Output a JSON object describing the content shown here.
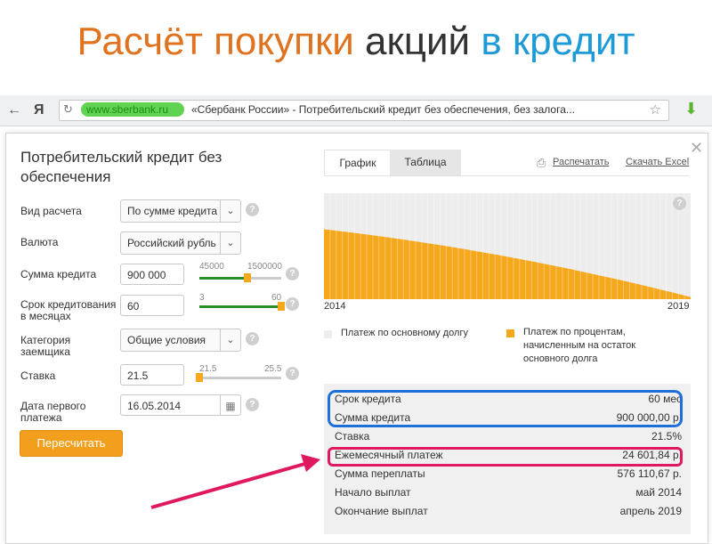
{
  "slide": {
    "title_part1": "Расчёт покупки",
    "title_part2": "акций",
    "title_part3": "в кредит"
  },
  "browser": {
    "back_icon": "←",
    "yandex_logo": "Я",
    "reload_icon": "↻",
    "url": "www.sberbank.ru",
    "page_title": "«Сбербанк России» - Потребительский кредит без обеспечения, без залога...",
    "star_icon": "☆",
    "download_icon": "⬇"
  },
  "dialog": {
    "title": "Потребительский кредит без обеспечения",
    "close_icon": "✕",
    "fields": {
      "calc_type": {
        "label": "Вид расчета",
        "value": "По сумме кредита"
      },
      "currency": {
        "label": "Валюта",
        "value": "Российский рубль"
      },
      "amount": {
        "label": "Сумма кредита",
        "value": "900 000",
        "min": "45000",
        "max": "1500000",
        "level_fraction": 0.59
      },
      "term": {
        "label": "Срок кредитования в месяцах",
        "value": "60",
        "min": "3",
        "max": "60",
        "level_fraction": 1.0
      },
      "category": {
        "label": "Категория заемщика",
        "value": "Общие условия"
      },
      "rate": {
        "label": "Ставка",
        "value": "21.5",
        "min": "21.5",
        "max": "25.5",
        "level_fraction": 0.0
      },
      "first_payment": {
        "label": "Дата первого платежа",
        "value": "16.05.2014"
      }
    },
    "help_icon": "?",
    "recalc_button": "Пересчитать",
    "tabs": {
      "graph": "График",
      "table": "Таблица"
    },
    "print_label": "Распечатать",
    "excel_label": "Скачать Excel",
    "legend": {
      "principal": "Платеж по основному долгу",
      "interest": "Платеж по процентам, начисленным на остаток основного долга"
    },
    "summary": [
      {
        "label": "Срок кредита",
        "value": "60 мес"
      },
      {
        "label": "Сумма кредита",
        "value": "900 000,00 р."
      },
      {
        "label": "Ставка",
        "value": "21.5%"
      },
      {
        "label": "Ежемесячный платеж",
        "value": "24 601,84 р."
      },
      {
        "label": "Сумма переплаты",
        "value": "576 110,67 р."
      },
      {
        "label": "Начало выплат",
        "value": "май 2014"
      },
      {
        "label": "Окончание выплат",
        "value": "апрель 2019"
      }
    ]
  },
  "colors": {
    "interest": "#f5a81c",
    "principal": "#ededed",
    "highlight_blue": "#1e6fd9",
    "highlight_pink": "#e0185f"
  },
  "chart_data": {
    "type": "area",
    "x_start": "2014",
    "x_end": "2019",
    "x_tick_labels": [
      "2014",
      "2019"
    ],
    "monthly_payment": 24601.84,
    "series": [
      {
        "name": "Платеж по основному долгу",
        "values_share_start": 0.34,
        "values_share_end": 0.98
      },
      {
        "name": "Платеж по процентам, начисленным на остаток основного долга",
        "values_share_start": 0.66,
        "values_share_end": 0.02
      }
    ]
  }
}
